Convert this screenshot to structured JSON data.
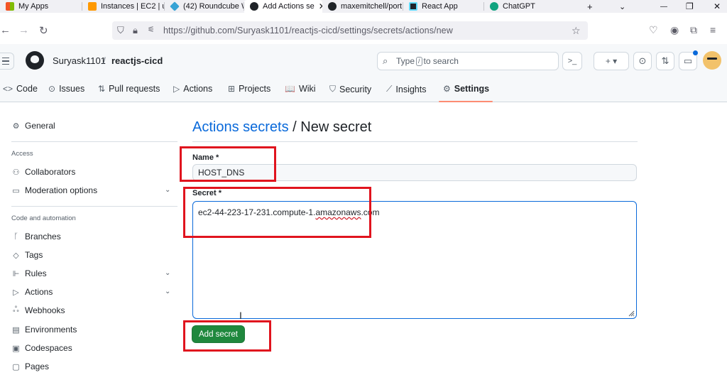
{
  "browser": {
    "tabs": [
      {
        "label": "My Apps",
        "color": "#f35325"
      },
      {
        "label": "Instances | EC2 | u",
        "color": "#ff9900"
      },
      {
        "label": "(42) Roundcube W",
        "color": "#37a3d5"
      },
      {
        "label": "Add Actions se",
        "color": "#1f2328",
        "active": true
      },
      {
        "label": "maxemitchell/port",
        "color": "#1f2328"
      },
      {
        "label": "React App",
        "color": "#61dafb"
      },
      {
        "label": "ChatGPT",
        "color": "#10a37f"
      }
    ],
    "new_tab": "+",
    "dropdown": "⌄",
    "close_tab": "✕",
    "window_min": "—",
    "window_max": "❐",
    "window_close": "✕",
    "back": "←",
    "forward": "→",
    "reload": "↻",
    "url": "https://github.com/Suryask1101/reactjs-cicd/settings/secrets/actions/new"
  },
  "github": {
    "owner": "Suryask1101",
    "separator": "/",
    "repo": "reactjs-cicd",
    "search_placeholder_pre": "Type",
    "search_key": "/",
    "search_placeholder_post": "to search",
    "cmd_palette": ">_",
    "plus": "+ ▾",
    "repo_tabs": [
      {
        "label": "Code",
        "icon": "<>"
      },
      {
        "label": "Issues",
        "icon": "⊙"
      },
      {
        "label": "Pull requests",
        "icon": "⇅"
      },
      {
        "label": "Actions",
        "icon": "▷"
      },
      {
        "label": "Projects",
        "icon": "⊞"
      },
      {
        "label": "Wiki",
        "icon": "📖"
      },
      {
        "label": "Security",
        "icon": "⛉"
      },
      {
        "label": "Insights",
        "icon": "⟋"
      },
      {
        "label": "Settings",
        "icon": "⚙",
        "active": true
      }
    ]
  },
  "sidebar": {
    "general": "General",
    "access_heading": "Access",
    "collaborators": "Collaborators",
    "moderation": "Moderation options",
    "code_heading": "Code and automation",
    "branches": "Branches",
    "tags": "Tags",
    "rules": "Rules",
    "actions": "Actions",
    "webhooks": "Webhooks",
    "environments": "Environments",
    "codespaces": "Codespaces",
    "pages": "Pages"
  },
  "main": {
    "title_link": "Actions secrets",
    "title_rest": " / New secret",
    "name_label": "Name *",
    "name_value": "HOST_DNS",
    "secret_label": "Secret *",
    "secret_value_pre": "ec2-44-223-17-231.compute-1.",
    "secret_value_squiggle": "amazonaws",
    "secret_value_post": ".com",
    "submit": "Add secret"
  },
  "colors": {
    "accent_link": "#0969da",
    "primary_button": "#1f883d",
    "annotation_red": "#e0141e",
    "active_tab_underline": "#fd8c73"
  }
}
